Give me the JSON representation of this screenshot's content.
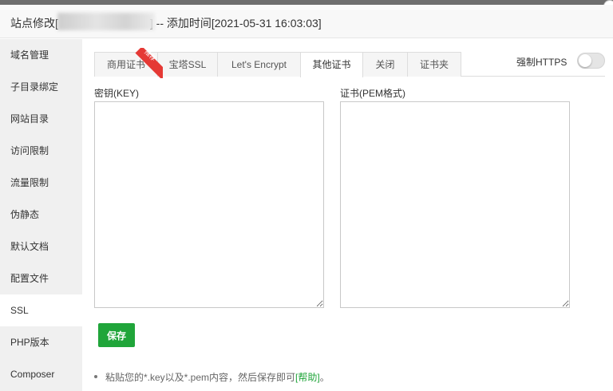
{
  "window": {
    "title_prefix": "站点修改[",
    "title_suffix": "] -- 添加时间[2021-05-31 16:03:03]"
  },
  "sidebar": {
    "items": [
      {
        "label": "域名管理"
      },
      {
        "label": "子目录绑定"
      },
      {
        "label": "网站目录"
      },
      {
        "label": "访问限制"
      },
      {
        "label": "流量限制"
      },
      {
        "label": "伪静态"
      },
      {
        "label": "默认文档"
      },
      {
        "label": "配置文件"
      },
      {
        "label": "SSL"
      },
      {
        "label": "PHP版本"
      },
      {
        "label": "Composer"
      }
    ],
    "active": "SSL"
  },
  "tabs": {
    "items": [
      {
        "label": "商用证书",
        "badge": "推荐"
      },
      {
        "label": "宝塔SSL"
      },
      {
        "label": "Let's Encrypt"
      },
      {
        "label": "其他证书"
      },
      {
        "label": "关闭"
      },
      {
        "label": "证书夹"
      }
    ],
    "active": "其他证书"
  },
  "force_https": {
    "label": "强制HTTPS",
    "enabled": false
  },
  "fields": {
    "key_label": "密钥(KEY)",
    "key_value": "",
    "cert_label": "证书(PEM格式)",
    "cert_value": ""
  },
  "actions": {
    "save_label": "保存"
  },
  "tip": {
    "text": "粘贴您的*.key以及*.pem内容，然后保存即可",
    "help_label": "[帮助]",
    "end": "。"
  },
  "colors": {
    "accent": "#20a53a",
    "badge": "#e53935"
  }
}
